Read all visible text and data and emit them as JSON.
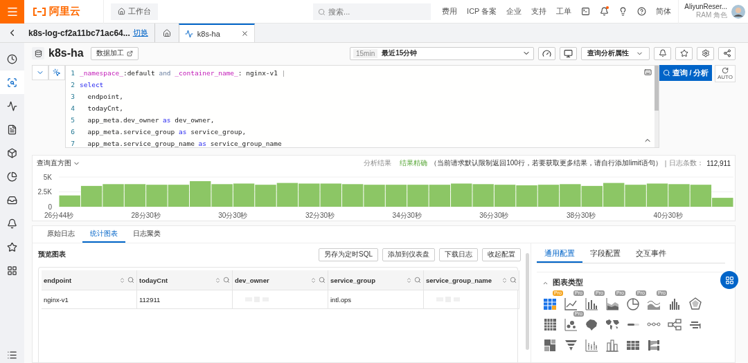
{
  "header": {
    "logo": "阿里云",
    "workbench": "工作台",
    "search_placeholder": "搜索...",
    "links": [
      "费用",
      "ICP 备案",
      "企业",
      "支持",
      "工单"
    ],
    "has_unread": true,
    "language": "简体",
    "user": "AliyunReser...",
    "role": "RAM 角色"
  },
  "project_bar": {
    "project": "k8s-log-cf2a11bc71ac64...",
    "switch_link": "切换",
    "tabs": [
      {
        "kind": "home",
        "selected": false
      },
      {
        "kind": "query",
        "label": "k8s-ha",
        "selected": true
      }
    ]
  },
  "sidebar": {
    "items": [
      {
        "kind": "history",
        "selected": false
      },
      {
        "kind": "query",
        "selected": true
      },
      {
        "kind": "monitor",
        "selected": false
      },
      {
        "kind": "report",
        "selected": false
      },
      {
        "kind": "package",
        "selected": false
      },
      {
        "kind": "chart",
        "selected": false
      },
      {
        "kind": "inbox",
        "selected": false
      },
      {
        "kind": "alert",
        "selected": false
      },
      {
        "kind": "favorite",
        "selected": false
      },
      {
        "kind": "apps",
        "selected": false
      }
    ]
  },
  "logstore": {
    "title": "k8s-ha",
    "data_process": "数据加工",
    "time_tag": "15min",
    "time_range": "最近15分钟",
    "properties": "查询分析属性",
    "search_button": "查询 / 分析",
    "auto_label": "AUTO"
  },
  "query_lines": [
    [
      {
        "kind": "field",
        "text": "_namespace_"
      },
      {
        "kind": "plain",
        "text": ":default "
      },
      {
        "kind": "operator",
        "text": "and "
      },
      {
        "kind": "field",
        "text": "_container_name_"
      },
      {
        "kind": "plain",
        "text": ": nginx-v1 "
      },
      {
        "kind": "pipe",
        "text": "|"
      }
    ],
    [
      {
        "kind": "keyword",
        "text": "select"
      }
    ],
    [
      {
        "kind": "plain",
        "text": "  endpoint,"
      }
    ],
    [
      {
        "kind": "plain",
        "text": "  todayCnt,"
      }
    ],
    [
      {
        "kind": "plain",
        "text": "  app_meta.dev_owner "
      },
      {
        "kind": "keyword",
        "text": "as"
      },
      {
        "kind": "plain",
        "text": " dev_owner,"
      }
    ],
    [
      {
        "kind": "plain",
        "text": "  app_meta.service_group "
      },
      {
        "kind": "keyword",
        "text": "as"
      },
      {
        "kind": "plain",
        "text": " service_group,"
      }
    ],
    [
      {
        "kind": "plain",
        "text": "  app_meta.service_group_name "
      },
      {
        "kind": "keyword",
        "text": "as"
      },
      {
        "kind": "plain",
        "text": " service_group_name"
      }
    ]
  ],
  "line_numbers": [
    "1",
    "2",
    "3",
    "4",
    "5",
    "6",
    "7"
  ],
  "histogram": {
    "title": "查询直方图",
    "result_label": "分析结果",
    "result_status": "结果精确",
    "result_note": "（当前请求默认限制返回100行，若要获取更多结果，请自行添加limit语句）",
    "separator": "|",
    "count_label": "日志条数：",
    "count": "112,911",
    "chart_data": {
      "type": "bar",
      "categories": [
        "26分44秒",
        null,
        null,
        null,
        "28分30秒",
        null,
        null,
        null,
        "30分30秒",
        null,
        null,
        null,
        "32分30秒",
        null,
        null,
        null,
        "34分30秒",
        null,
        null,
        null,
        "36分30秒",
        null,
        null,
        null,
        "38分30秒",
        null,
        null,
        null,
        "40分30秒",
        null,
        null
      ],
      "values": [
        1900,
        3500,
        3800,
        3800,
        3700,
        3700,
        4300,
        3800,
        3900,
        3700,
        4000,
        3900,
        3900,
        3800,
        3700,
        3700,
        3700,
        3700,
        3900,
        3800,
        3700,
        3600,
        3700,
        3800,
        3500,
        4000,
        3700,
        3900,
        3800,
        3700,
        1500
      ],
      "ylim": [
        0,
        5000
      ],
      "yticks": [
        {
          "value": 0,
          "label": "0"
        },
        {
          "value": 2500,
          "label": "2.5K"
        },
        {
          "value": 5000,
          "label": "5K"
        }
      ]
    }
  },
  "result_tabs": [
    {
      "label": "原始日志",
      "selected": false
    },
    {
      "label": "统计图表",
      "selected": true
    },
    {
      "label": "日志聚类",
      "selected": false
    }
  ],
  "preview": {
    "title": "预览图表",
    "actions": [
      "另存为定时SQL",
      "添加到仪表盘",
      "下载日志",
      "收起配置"
    ]
  },
  "table": {
    "columns": [
      "endpoint",
      "todayCnt",
      "dev_owner",
      "service_group",
      "service_group_name"
    ],
    "rows": [
      [
        {
          "text": "nginx-v1"
        },
        {
          "text": "112911"
        },
        {
          "kind": "redacted"
        },
        {
          "text": "intl.ops"
        },
        {
          "kind": "redacted"
        }
      ]
    ]
  },
  "config_tabs": [
    {
      "label": "通用配置",
      "selected": true
    },
    {
      "label": "字段配置",
      "selected": false
    },
    {
      "label": "交互事件",
      "selected": false
    }
  ],
  "chart_type_section": {
    "title": "图表类型",
    "expanded": true
  },
  "chart_types": [
    {
      "kind": "table",
      "badge": "Pro",
      "selected": true
    },
    {
      "kind": "line",
      "badge": "Pro",
      "selected": false
    },
    {
      "kind": "bar",
      "badge": "Pro",
      "selected": false
    },
    {
      "kind": "area",
      "badge": "Pro",
      "selected": false
    },
    {
      "kind": "pie",
      "badge": "Pro",
      "selected": false
    },
    {
      "kind": "wave",
      "badge": "Pro",
      "selected": false
    },
    {
      "kind": "histogram",
      "selected": false
    },
    {
      "kind": "radar",
      "selected": false
    },
    {
      "kind": "grid",
      "selected": false
    },
    {
      "kind": "scatter",
      "badge": "Pro",
      "selected": false
    },
    {
      "kind": "map",
      "selected": false
    },
    {
      "kind": "worldmap",
      "selected": false
    },
    {
      "kind": "progress",
      "selected": false
    },
    {
      "kind": "flow",
      "selected": false
    },
    {
      "kind": "topology",
      "selected": false
    },
    {
      "kind": "cloud",
      "selected": false
    },
    {
      "kind": "treemap",
      "selected": false
    },
    {
      "kind": "funnel",
      "selected": false
    },
    {
      "kind": "candle",
      "selected": false
    },
    {
      "kind": "column",
      "selected": false
    },
    {
      "kind": "crosstable",
      "selected": false
    },
    {
      "kind": "sankey",
      "selected": false
    }
  ]
}
